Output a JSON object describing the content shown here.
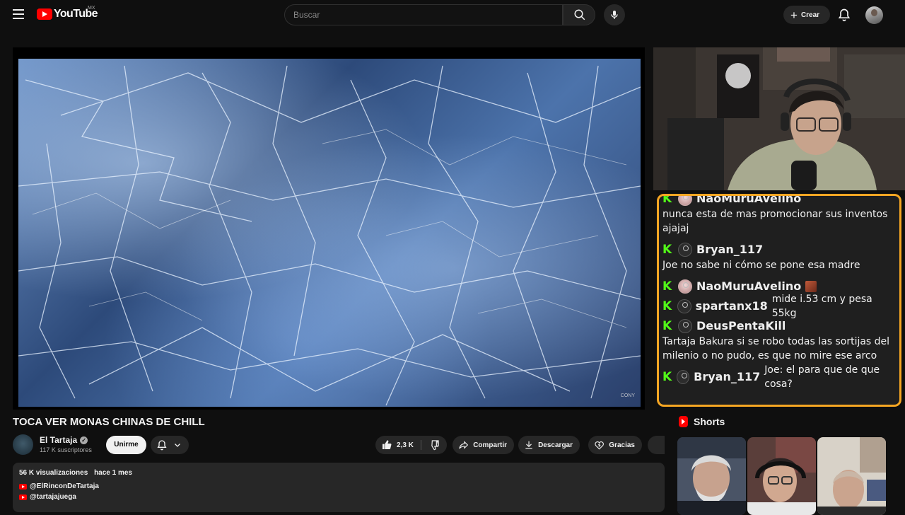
{
  "header": {
    "logo_text": "YouTube",
    "country_code": "MX",
    "search_placeholder": "Buscar",
    "create_label": "Crear"
  },
  "video": {
    "watermark": "CONY",
    "title": "TOCA VER MONAS CHINAS DE CHILL"
  },
  "channel": {
    "name": "El Tartaja",
    "subscribers": "117 K suscriptores",
    "join_label": "Unirme"
  },
  "actions": {
    "likes": "2,3 K",
    "share_label": "Compartir",
    "download_label": "Descargar",
    "thanks_label": "Gracias"
  },
  "description": {
    "views": "56 K visualizaciones",
    "date": "hace 1 mes",
    "links": [
      "@ElRinconDeTartaja",
      "@tartajajuega"
    ]
  },
  "chat": {
    "messages": [
      {
        "user": "NaoMuruAvelino",
        "text": "nunca esta de mas promocionar sus inventos ajajaj"
      },
      {
        "user": "Bryan_117",
        "text": "Joe no sabe ni cómo se pone esa madre"
      },
      {
        "user": "NaoMuruAvelino",
        "text": ""
      },
      {
        "user": "spartanx18",
        "text": "mide i.53 cm y pesa 55kg"
      },
      {
        "user": "DeusPentaKill",
        "text": "Tartaja Bakura si se robo todas las sortijas del milenio o no pudo, es que no mire ese arco"
      },
      {
        "user": "Bryan_117",
        "text": "Joe: el para que de que cosa?"
      }
    ],
    "badge_letter": "K"
  },
  "shorts": {
    "heading": "Shorts"
  },
  "icons": {
    "menu": "menu-icon",
    "search": "search-icon",
    "mic": "mic-icon",
    "bell": "bell-icon",
    "plus": "plus-icon"
  },
  "colors": {
    "background": "#0f0f0f",
    "brand_red": "#ff0000",
    "chat_border": "#f5a623",
    "kick_green": "#53fc18"
  }
}
